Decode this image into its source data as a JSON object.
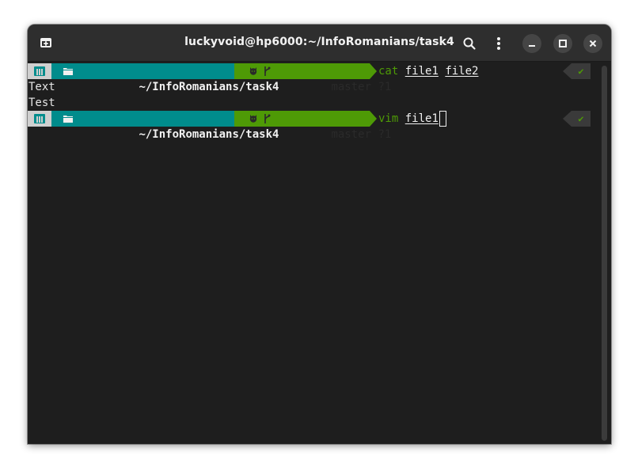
{
  "window": {
    "title": "luckyvoid@hp6000:~/InfoRomanians/task4"
  },
  "prompt": {
    "directory": "~/InfoRomanians/task4",
    "git_branch": "master ?1",
    "status_ok": "✔"
  },
  "lines": [
    {
      "command": "cat",
      "args": [
        "file1",
        "file2"
      ]
    },
    {
      "output": "Text"
    },
    {
      "output": "Test"
    },
    {
      "command": "vim",
      "args": [
        "file1"
      ]
    }
  ],
  "colors": {
    "dir_segment": "#008c8c",
    "git_segment": "#4e9a06",
    "os_segment": "#cfcfcf",
    "terminal_bg": "#1e1e1e",
    "titlebar_bg": "#2e2e2e"
  },
  "icons": {
    "new_tab": "new-tab-icon",
    "search": "search-icon",
    "menu": "kebab-menu-icon",
    "minimize": "minimize-icon",
    "maximize": "maximize-icon",
    "close": "close-icon"
  }
}
